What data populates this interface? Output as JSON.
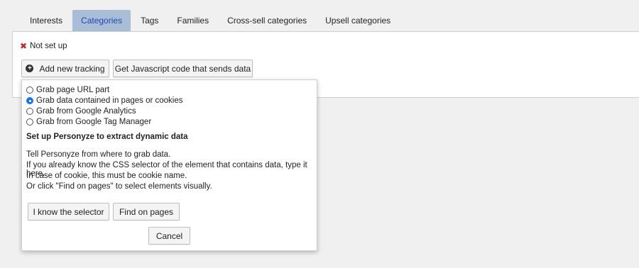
{
  "tabs": [
    "Interests",
    "Categories",
    "Tags",
    "Families",
    "Cross-sell categories",
    "Upsell categories"
  ],
  "status": {
    "icon": "x-icon",
    "text": "Not set up"
  },
  "toolbar": {
    "add_tracking_label": "Add new tracking",
    "get_js_label": "Get Javascript code that sends data"
  },
  "popup": {
    "options": [
      "Grab page URL part",
      "Grab data contained in pages or cookies",
      "Grab from Google Analytics",
      "Grab from Google Tag Manager"
    ],
    "selected_option": "Grab data contained in pages or cookies",
    "heading": "Set up Personyze to extract dynamic data",
    "desc1": "Tell Personyze from where to grab data.",
    "desc2": "If you already know the CSS selector of the element that contains data, type it here.",
    "desc3": "In case of cookie, this must be cookie name.",
    "desc4": "Or click \"Find on pages\" to select elements visually.",
    "know_selector_label": "I know the selector",
    "find_on_pages_label": "Find on pages",
    "cancel_label": "Cancel"
  },
  "colors": {
    "active_tab_bg": "#a9bdd6",
    "active_tab_text": "#1b4bb0",
    "radio_accent": "#1a73e8",
    "status_x": "#c62828"
  }
}
